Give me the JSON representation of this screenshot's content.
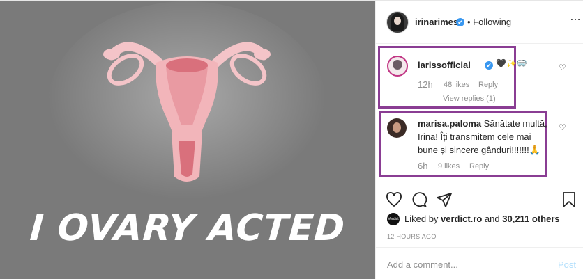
{
  "post": {
    "image_caption": "I OVARY ACTED",
    "author": "irinarimes",
    "follow_status": "Following",
    "more_icon": "more-horizontal-icon"
  },
  "comments": [
    {
      "username": "larissofficial",
      "text": "🖤✨🥽",
      "time": "12h",
      "likes": "48 likes",
      "reply": "Reply",
      "view_replies": "View replies (1)"
    },
    {
      "username": "marisa.paloma",
      "text": "Sănătate multă, Irina! Îți transmitem cele mai bune și sincere gânduri!!!!!!!🙏",
      "time": "6h",
      "likes": "9 likes",
      "reply": "Reply"
    }
  ],
  "actions": {
    "like_icon": "heart-outline-icon",
    "comment_icon": "comment-bubble-icon",
    "share_icon": "paper-plane-icon",
    "save_icon": "bookmark-icon"
  },
  "liked_by": {
    "prefix": "Liked by",
    "user": "verdict.ro",
    "conjunction": "and",
    "others": "30,211 others",
    "avatar_label": "Verdict"
  },
  "timestamp": "12 HOURS AGO",
  "add_comment": {
    "placeholder": "Add a comment...",
    "post_label": "Post"
  },
  "colors": {
    "highlight_border": "#8a3d93",
    "verified_blue": "#3897f0",
    "image_background": "#7a7a7a"
  }
}
